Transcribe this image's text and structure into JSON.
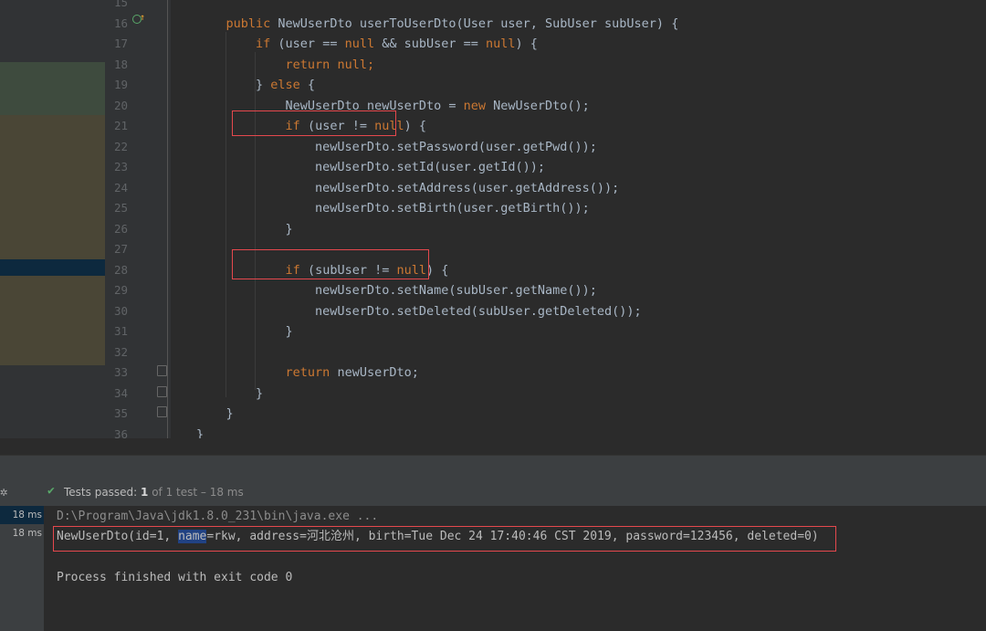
{
  "editor": {
    "line_numbers": [
      "15",
      "16",
      "17",
      "18",
      "19",
      "20",
      "21",
      "22",
      "23",
      "24",
      "25",
      "26",
      "27",
      "28",
      "29",
      "30",
      "31",
      "32",
      "33",
      "34",
      "35",
      "36"
    ],
    "code_lines": [
      {
        "n": "15",
        "segments": []
      },
      {
        "n": "16",
        "segments": [
          {
            "t": "    ",
            "c": "id"
          },
          {
            "t": "public ",
            "c": "kw"
          },
          {
            "t": "NewUserDto userToUserDto(User user, SubUser subUser) {",
            "c": "id"
          }
        ]
      },
      {
        "n": "17",
        "segments": [
          {
            "t": "        ",
            "c": "id"
          },
          {
            "t": "if ",
            "c": "kw"
          },
          {
            "t": "(user == ",
            "c": "id"
          },
          {
            "t": "null ",
            "c": "kw"
          },
          {
            "t": "&& subUser == ",
            "c": "id"
          },
          {
            "t": "null",
            "c": "kw"
          },
          {
            "t": ") {",
            "c": "id"
          }
        ]
      },
      {
        "n": "18",
        "segments": [
          {
            "t": "            ",
            "c": "id"
          },
          {
            "t": "return null;",
            "c": "kw"
          }
        ]
      },
      {
        "n": "19",
        "segments": [
          {
            "t": "        } ",
            "c": "id"
          },
          {
            "t": "else ",
            "c": "kw"
          },
          {
            "t": "{",
            "c": "id"
          }
        ]
      },
      {
        "n": "20",
        "segments": [
          {
            "t": "            NewUserDto newUserDto = ",
            "c": "id"
          },
          {
            "t": "new ",
            "c": "kw"
          },
          {
            "t": "NewUserDto();",
            "c": "id"
          }
        ]
      },
      {
        "n": "21",
        "segments": [
          {
            "t": "            ",
            "c": "id"
          },
          {
            "t": "if ",
            "c": "kw"
          },
          {
            "t": "(user != ",
            "c": "id"
          },
          {
            "t": "null",
            "c": "kw"
          },
          {
            "t": ") {",
            "c": "id"
          }
        ]
      },
      {
        "n": "22",
        "segments": [
          {
            "t": "                newUserDto.setPassword(user.getPwd());",
            "c": "id"
          }
        ]
      },
      {
        "n": "23",
        "segments": [
          {
            "t": "                newUserDto.setId(user.getId());",
            "c": "id"
          }
        ]
      },
      {
        "n": "24",
        "segments": [
          {
            "t": "                newUserDto.setAddress(user.getAddress());",
            "c": "id"
          }
        ]
      },
      {
        "n": "25",
        "segments": [
          {
            "t": "                newUserDto.setBirth(user.getBirth());",
            "c": "id"
          }
        ]
      },
      {
        "n": "26",
        "segments": [
          {
            "t": "            }",
            "c": "id"
          }
        ]
      },
      {
        "n": "27",
        "segments": []
      },
      {
        "n": "28",
        "segments": [
          {
            "t": "            ",
            "c": "id"
          },
          {
            "t": "if ",
            "c": "kw"
          },
          {
            "t": "(subUser != ",
            "c": "id"
          },
          {
            "t": "null",
            "c": "kw"
          },
          {
            "t": ") {",
            "c": "id"
          }
        ]
      },
      {
        "n": "29",
        "segments": [
          {
            "t": "                newUserDto.setName(subUser.getName());",
            "c": "id"
          }
        ]
      },
      {
        "n": "30",
        "segments": [
          {
            "t": "                newUserDto.setDeleted(subUser.getDeleted());",
            "c": "id"
          }
        ]
      },
      {
        "n": "31",
        "segments": [
          {
            "t": "            }",
            "c": "id"
          }
        ]
      },
      {
        "n": "32",
        "segments": []
      },
      {
        "n": "33",
        "segments": [
          {
            "t": "            ",
            "c": "id"
          },
          {
            "t": "return ",
            "c": "kw"
          },
          {
            "t": "newUserDto;",
            "c": "id"
          }
        ]
      },
      {
        "n": "34",
        "segments": [
          {
            "t": "        }",
            "c": "id"
          }
        ]
      },
      {
        "n": "35",
        "segments": [
          {
            "t": "    }",
            "c": "id"
          }
        ]
      },
      {
        "n": "36",
        "segments": [
          {
            "t": "}",
            "c": "id"
          }
        ]
      }
    ]
  },
  "tests": {
    "status_prefix": "Tests passed: ",
    "passed_count": "1",
    "status_suffix": " of 1 test",
    "duration": " – 18 ms"
  },
  "timings": [
    "18 ms",
    "18 ms"
  ],
  "console": {
    "command": "D:\\Program\\Java\\jdk1.8.0_231\\bin\\java.exe ...",
    "output_prefix": "NewUserDto(id=1, ",
    "output_selected": "name",
    "output_suffix": "=rkw, address=河北沧州, birth=Tue Dec 24 17:40:46 CST 2019, password=123456, deleted=0)",
    "finish": "Process finished with exit code 0"
  },
  "colors": {
    "editor_bg": "#2b2b2b",
    "keyword": "#cc7832",
    "identifier": "#a9b7c6",
    "highlight_border": "#e5484d",
    "pass_green": "#59a869",
    "selection": "#214283"
  }
}
